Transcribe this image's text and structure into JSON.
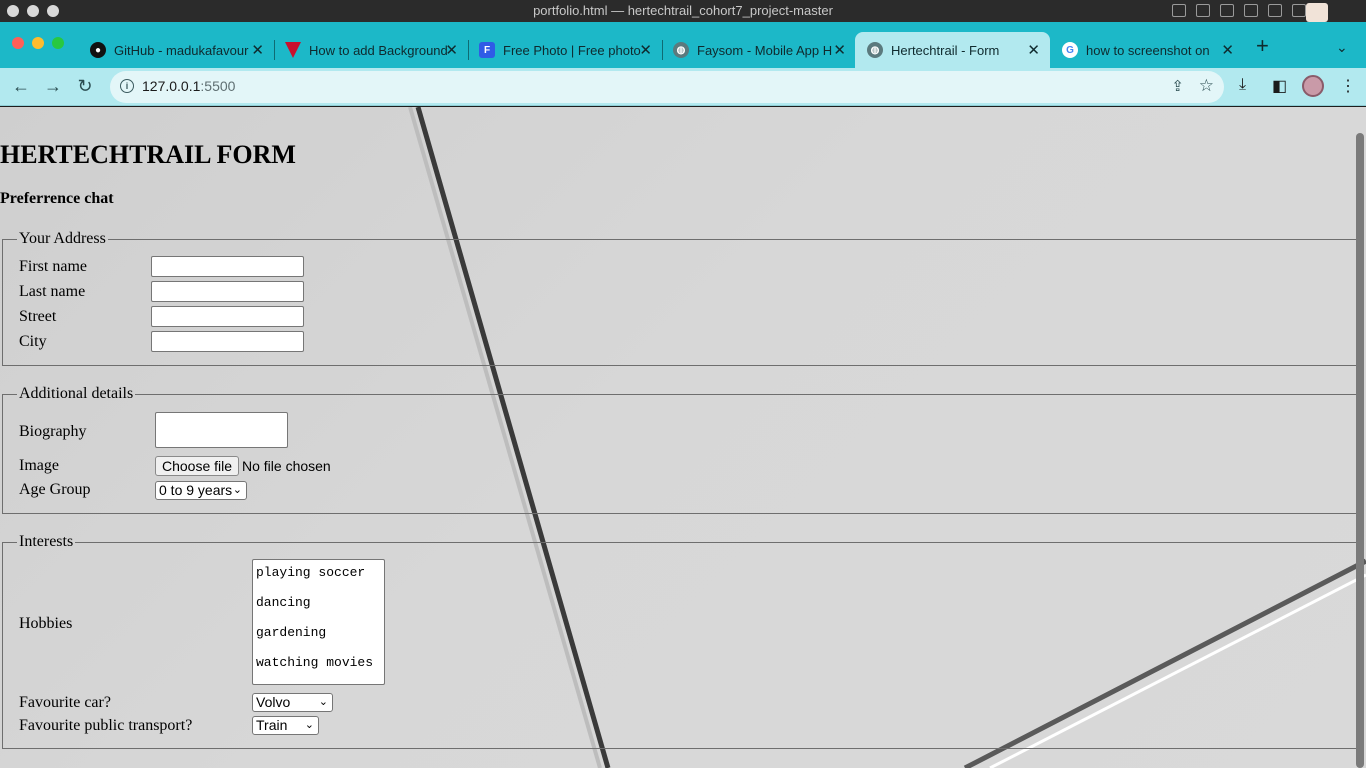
{
  "window": {
    "title": "portfolio.html — hertechtrail_cohort7_project-master"
  },
  "tabs": [
    {
      "label": "GitHub - madukafavour",
      "icon": "github-icon",
      "active": false
    },
    {
      "label": "How to add Background",
      "icon": "vercel-icon",
      "active": false
    },
    {
      "label": "Free Photo | Free photo",
      "icon": "freepik-icon",
      "active": false
    },
    {
      "label": "Faysom - Mobile App H",
      "icon": "globe-icon",
      "active": false
    },
    {
      "label": "Hertechtrail - Form",
      "icon": "globe-icon",
      "active": true
    },
    {
      "label": "how to screenshot on",
      "icon": "google-icon",
      "active": false
    }
  ],
  "toolbar": {
    "url_host": "127.0.0.1",
    "url_port": ":5500"
  },
  "page": {
    "heading": "HERTECHTRAIL FORM",
    "subtitle": "Preferrence chat",
    "address": {
      "legend": "Your Address",
      "fields": [
        {
          "label": "First name",
          "value": ""
        },
        {
          "label": "Last name",
          "value": ""
        },
        {
          "label": "Street",
          "value": ""
        },
        {
          "label": "City",
          "value": ""
        }
      ]
    },
    "details": {
      "legend": "Additional details",
      "biography_label": "Biography",
      "image_label": "Image",
      "choose_file": "Choose file",
      "no_file": "No file chosen",
      "age_label": "Age Group",
      "age_value": "0 to 9 years"
    },
    "interests": {
      "legend": "Interests",
      "hobbies_label": "Hobbies",
      "hobbies": [
        "playing soccer",
        "dancing",
        "gardening",
        "watching movies"
      ],
      "car_label": "Favourite car?",
      "car_value": "Volvo",
      "transport_label": "Favourite public transport?",
      "transport_value": "Train"
    }
  }
}
